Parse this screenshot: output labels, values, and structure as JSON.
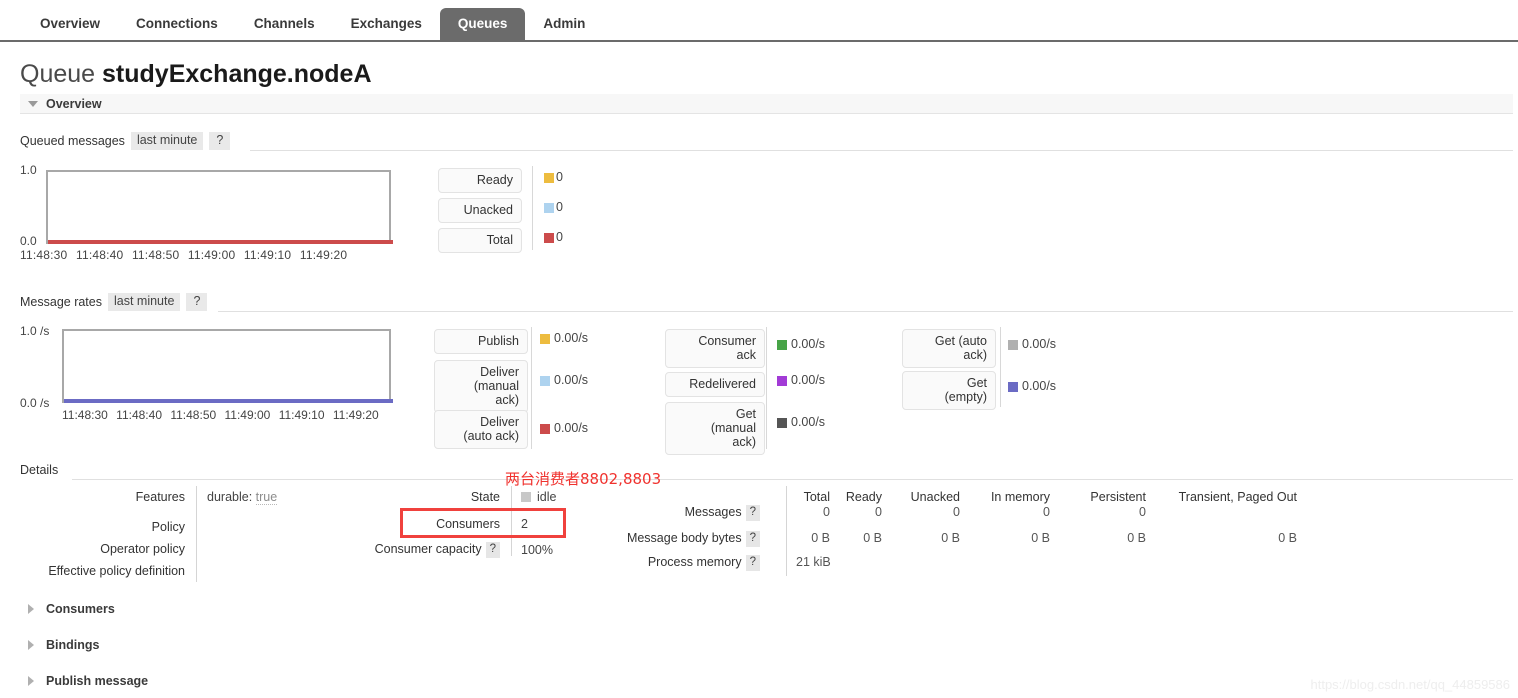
{
  "nav": {
    "tabs": [
      {
        "label": "Overview",
        "active": false
      },
      {
        "label": "Connections",
        "active": false
      },
      {
        "label": "Channels",
        "active": false
      },
      {
        "label": "Exchanges",
        "active": false
      },
      {
        "label": "Queues",
        "active": true
      },
      {
        "label": "Admin",
        "active": false
      }
    ]
  },
  "page": {
    "title_prefix": "Queue",
    "title_name": "studyExchange.nodeA",
    "overview_section": "Overview"
  },
  "queued_messages": {
    "title": "Queued messages",
    "period": "last minute",
    "help": "?",
    "legend": [
      {
        "label": "Ready",
        "color": "#edbc3f",
        "value": "0"
      },
      {
        "label": "Unacked",
        "color": "#aed3ef",
        "value": "0"
      },
      {
        "label": "Total",
        "color": "#cc4b4b",
        "value": "0"
      }
    ]
  },
  "message_rates": {
    "title": "Message rates",
    "period": "last minute",
    "help": "?",
    "legend_col1": [
      {
        "label": "Publish",
        "color": "#edbc3f",
        "value": "0.00/s"
      },
      {
        "label": "Deliver\n(manual\nack)",
        "color": "#aed3ef",
        "value": "0.00/s"
      },
      {
        "label": "Deliver\n(auto ack)",
        "color": "#cc4b4b",
        "value": "0.00/s"
      }
    ],
    "legend_col2": [
      {
        "label": "Consumer\nack",
        "color": "#47a447",
        "value": "0.00/s"
      },
      {
        "label": "Redelivered",
        "color": "#a23bd6",
        "value": "0.00/s"
      },
      {
        "label": "Get\n(manual\nack)",
        "color": "#555555",
        "value": "0.00/s"
      }
    ],
    "legend_col3": [
      {
        "label": "Get (auto\nack)",
        "color": "#b0b0b0",
        "value": "0.00/s"
      },
      {
        "label": "Get\n(empty)",
        "color": "#6b6bc4",
        "value": "0.00/s"
      }
    ]
  },
  "chart_data": [
    {
      "type": "line",
      "title": "Queued messages",
      "subtitle": "last minute",
      "xlabel": "",
      "ylabel": "",
      "ylim": [
        0.0,
        1.0
      ],
      "ytick_labels": [
        "0.0",
        "1.0"
      ],
      "x": [
        "11:48:30",
        "11:48:40",
        "11:48:50",
        "11:49:00",
        "11:49:10",
        "11:49:20"
      ],
      "grid": false,
      "legend_position": "right",
      "series": [
        {
          "name": "Ready",
          "color": "#edbc3f",
          "values": [
            0,
            0,
            0,
            0,
            0,
            0
          ]
        },
        {
          "name": "Unacked",
          "color": "#aed3ef",
          "values": [
            0,
            0,
            0,
            0,
            0,
            0
          ]
        },
        {
          "name": "Total",
          "color": "#cc4b4b",
          "values": [
            0,
            0,
            0,
            0,
            0,
            0
          ]
        }
      ]
    },
    {
      "type": "line",
      "title": "Message rates",
      "subtitle": "last minute",
      "xlabel": "",
      "ylabel": "/s",
      "ylim": [
        0.0,
        1.0
      ],
      "ytick_labels": [
        "0.0 /s",
        "1.0 /s"
      ],
      "x": [
        "11:48:30",
        "11:48:40",
        "11:48:50",
        "11:49:00",
        "11:49:10",
        "11:49:20"
      ],
      "grid": false,
      "legend_position": "right",
      "series": [
        {
          "name": "Publish",
          "color": "#edbc3f",
          "values": [
            0,
            0,
            0,
            0,
            0,
            0
          ]
        },
        {
          "name": "Deliver (manual ack)",
          "color": "#aed3ef",
          "values": [
            0,
            0,
            0,
            0,
            0,
            0
          ]
        },
        {
          "name": "Deliver (auto ack)",
          "color": "#cc4b4b",
          "values": [
            0,
            0,
            0,
            0,
            0,
            0
          ]
        },
        {
          "name": "Consumer ack",
          "color": "#47a447",
          "values": [
            0,
            0,
            0,
            0,
            0,
            0
          ]
        },
        {
          "name": "Redelivered",
          "color": "#a23bd6",
          "values": [
            0,
            0,
            0,
            0,
            0,
            0
          ]
        },
        {
          "name": "Get (manual ack)",
          "color": "#555555",
          "values": [
            0,
            0,
            0,
            0,
            0,
            0
          ]
        },
        {
          "name": "Get (auto ack)",
          "color": "#b0b0b0",
          "values": [
            0,
            0,
            0,
            0,
            0,
            0
          ]
        },
        {
          "name": "Get (empty)",
          "color": "#6b6bc4",
          "values": [
            0,
            0,
            0,
            0,
            0,
            0
          ]
        }
      ]
    }
  ],
  "details": {
    "heading": "Details",
    "left_labels": [
      "Features",
      "Policy",
      "Operator policy",
      "Effective policy definition"
    ],
    "features_key": "durable:",
    "features_value": "true",
    "state_label": "State",
    "state_value": "idle",
    "consumers_label": "Consumers",
    "consumers_value": "2",
    "consumer_capacity_label": "Consumer capacity",
    "consumer_capacity_help": "?",
    "consumer_capacity_value": "100%",
    "columns": [
      "Total",
      "Ready",
      "Unacked",
      "In memory",
      "Persistent",
      "Transient, Paged Out"
    ],
    "rows": [
      {
        "label": "Messages",
        "help": "?",
        "values": [
          "0",
          "0",
          "0",
          "0",
          "0",
          ""
        ]
      },
      {
        "label": "Message body bytes",
        "help": "?",
        "values": [
          "0 B",
          "0 B",
          "0 B",
          "0 B",
          "0 B",
          "0 B"
        ]
      },
      {
        "label": "Process memory",
        "help": "?",
        "values": [
          "21 kiB",
          "",
          "",
          "",
          "",
          ""
        ]
      }
    ]
  },
  "annotation": {
    "text": "两台消费者8802,8803",
    "color": "#f0322e"
  },
  "collapsed_sections": [
    {
      "label": "Consumers"
    },
    {
      "label": "Bindings"
    },
    {
      "label": "Publish message"
    }
  ],
  "watermark": "https://blog.csdn.net/qq_44859586"
}
